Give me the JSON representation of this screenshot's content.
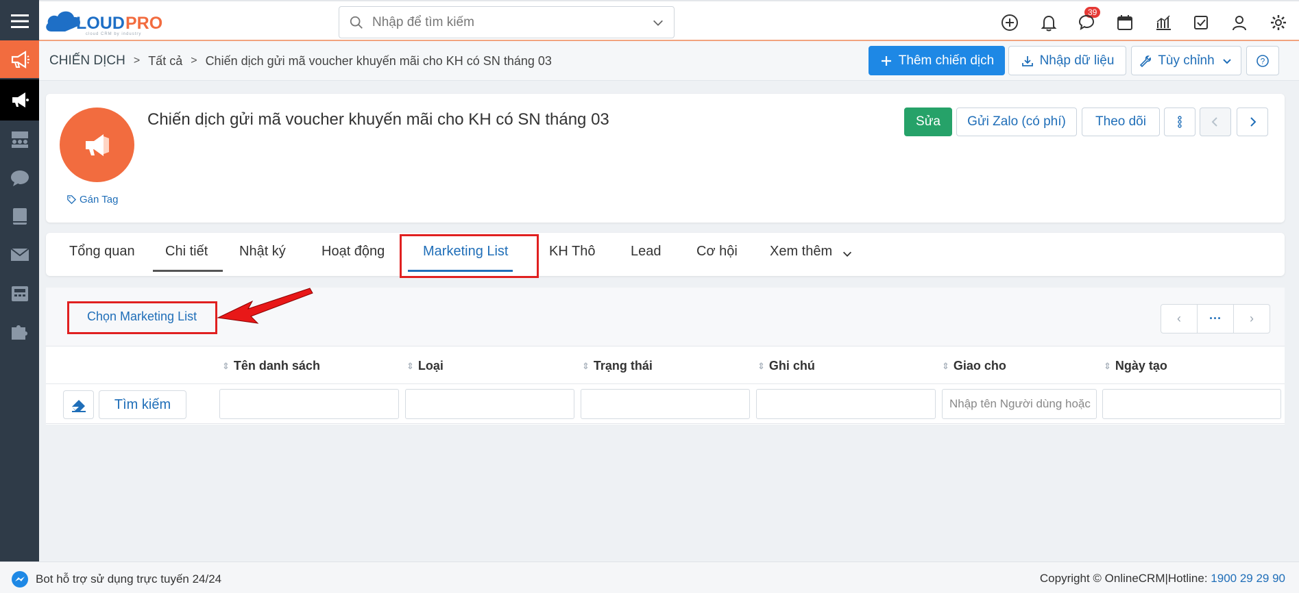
{
  "topbar": {
    "logo_text": "CLOUDPRO",
    "logo_sub": "cloud CRM by industry",
    "search_placeholder": "Nhập để tìm kiếm",
    "notification_count": "39",
    "icons": [
      "plus-circle-icon",
      "bell-icon",
      "chat-icon",
      "calendar-icon",
      "chart-icon",
      "checkbox-icon",
      "user-icon",
      "gear-icon"
    ]
  },
  "breadcrumb": {
    "module": "CHIẾN DỊCH",
    "all": "Tất cả",
    "current": "Chiến dịch gửi mã voucher khuyến mãi cho KH có SN tháng 03"
  },
  "actions": {
    "add": "Thêm chiến dịch",
    "import": "Nhập dữ liệu",
    "customize": "Tùy chỉnh",
    "help": "?"
  },
  "record": {
    "title": "Chiến dịch gửi mã voucher khuyến mãi cho KH có SN tháng 03",
    "tag": "Gán Tag",
    "edit": "Sửa",
    "zalo": "Gửi Zalo (có phí)",
    "follow": "Theo dõi"
  },
  "tabs": [
    {
      "label": "Tổng quan"
    },
    {
      "label": "Chi tiết"
    },
    {
      "label": "Nhật ký"
    },
    {
      "label": "Hoạt động"
    },
    {
      "label": "Marketing List"
    },
    {
      "label": "KH Thô"
    },
    {
      "label": "Lead"
    },
    {
      "label": "Cơ hội"
    },
    {
      "label": "Xem thêm"
    }
  ],
  "list": {
    "choose_link": "Chọn Marketing List",
    "columns": [
      "Tên danh sách",
      "Loại",
      "Trạng thái",
      "Ghi chú",
      "Giao cho",
      "Ngày tạo"
    ],
    "assign_placeholder": "Nhập tên Người dùng hoặc",
    "search_button": "Tìm kiếm",
    "pager": {
      "prev": "‹",
      "more": "···",
      "next": "›"
    }
  },
  "footer": {
    "bot": "Bot hỗ trợ sử dụng trực tuyến 24/24",
    "copyright": "Copyright © OnlineCRM|Hotline: ",
    "hotline": "1900 29 29 90"
  },
  "colors": {
    "accent_orange": "#f26c3f",
    "primary_blue": "#1e88e5",
    "link_blue": "#1f6eb8",
    "edit_green": "#26a269",
    "sidebar_bg": "#2f3b48",
    "highlight_red": "#e02020"
  }
}
